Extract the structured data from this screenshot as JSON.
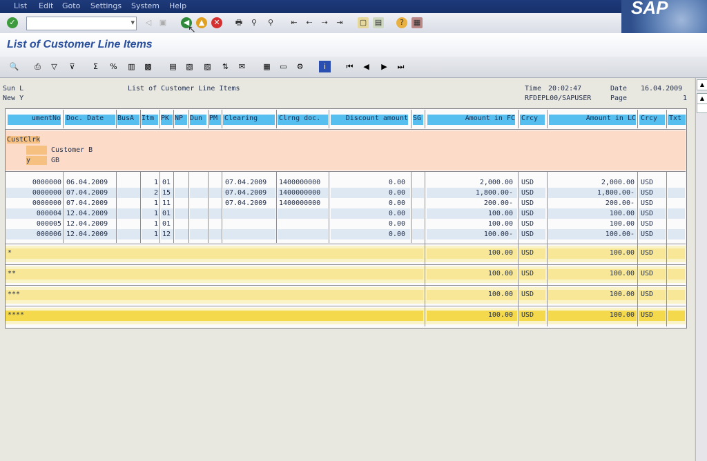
{
  "menu": [
    "List",
    "Edit",
    "Goto",
    "Settings",
    "System",
    "Help"
  ],
  "brand": "SAP",
  "title": "List of Customer Line Items",
  "report_header": {
    "left1": "Sun L",
    "left2": "New Y",
    "center": "List of Customer Line Items",
    "time_label": "Time",
    "time": "20:02:47",
    "date_label": "Date",
    "date": "16.04.2009",
    "program": "RFDEPL00/SAPUSER",
    "page_label": "Page",
    "page": "1"
  },
  "columns": [
    "umentNo",
    "Doc. Date",
    "BusA",
    "Itm",
    "PK",
    "NP",
    "Dun",
    "PM",
    "Clearing",
    "Clrng doc.",
    "Discount amount",
    "SG",
    "Amount in FC",
    "Crcy",
    "Amount in LC",
    "Crcy",
    "Txt"
  ],
  "customer": {
    "label": "CustClrk",
    "name": "Customer B",
    "country_key": "y",
    "country": "GB"
  },
  "rows": [
    {
      "doc": "0000000",
      "date": "06.04.2009",
      "itm": "1",
      "pk": "01",
      "clearing": "07.04.2009",
      "clrng": "1400000000",
      "disc": "0.00",
      "fc": "2,000.00",
      "crcy": "USD",
      "lc": "2,000.00",
      "crcy2": "USD"
    },
    {
      "doc": "0000000",
      "date": "07.04.2009",
      "itm": "2",
      "pk": "15",
      "clearing": "07.04.2009",
      "clrng": "1400000000",
      "disc": "0.00",
      "fc": "1,800.00-",
      "crcy": "USD",
      "lc": "1,800.00-",
      "crcy2": "USD"
    },
    {
      "doc": "0000000",
      "date": "07.04.2009",
      "itm": "1",
      "pk": "11",
      "clearing": "07.04.2009",
      "clrng": "1400000000",
      "disc": "0.00",
      "fc": "200.00-",
      "crcy": "USD",
      "lc": "200.00-",
      "crcy2": "USD"
    },
    {
      "doc": "000004",
      "date": "12.04.2009",
      "itm": "1",
      "pk": "01",
      "clearing": "",
      "clrng": "",
      "disc": "0.00",
      "fc": "100.00",
      "crcy": "USD",
      "lc": "100.00",
      "crcy2": "USD"
    },
    {
      "doc": "000005",
      "date": "12.04.2009",
      "itm": "1",
      "pk": "01",
      "clearing": "",
      "clrng": "",
      "disc": "0.00",
      "fc": "100.00",
      "crcy": "USD",
      "lc": "100.00",
      "crcy2": "USD"
    },
    {
      "doc": "000006",
      "date": "12.04.2009",
      "itm": "1",
      "pk": "12",
      "clearing": "",
      "clrng": "",
      "disc": "0.00",
      "fc": "100.00-",
      "crcy": "USD",
      "lc": "100.00-",
      "crcy2": "USD"
    }
  ],
  "totals": [
    {
      "label": "*",
      "fc": "100.00",
      "crcy": "USD",
      "lc": "100.00",
      "crcy2": "USD"
    },
    {
      "label": "**",
      "fc": "100.00",
      "crcy": "USD",
      "lc": "100.00",
      "crcy2": "USD"
    },
    {
      "label": "***",
      "fc": "100.00",
      "crcy": "USD",
      "lc": "100.00",
      "crcy2": "USD"
    },
    {
      "label": "****",
      "fc": "100.00",
      "crcy": "USD",
      "lc": "100.00",
      "crcy2": "USD"
    }
  ],
  "colors": {
    "header_blue": "#56bff0",
    "customer_bg": "#fcdcc8",
    "total_bg": "#fbf3c8",
    "grand_total": "#f5d94d",
    "title_blue": "#2a4f9c"
  }
}
